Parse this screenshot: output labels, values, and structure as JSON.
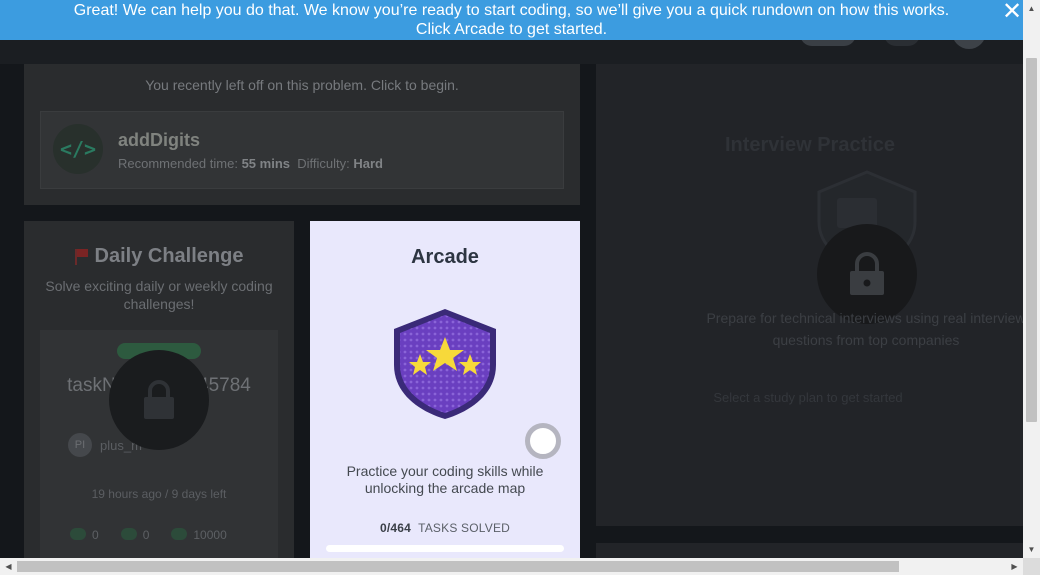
{
  "banner": {
    "line1": "Great! We can help you do that. We know you’re ready to start coding, so we’ll give you a quick rundown on how this works.",
    "line2": "Click Arcade to get started.",
    "close_glyph": "✕"
  },
  "resume": {
    "prompt": "You recently left off on this problem. Click to begin.",
    "problem_name": "addDigits",
    "icon_glyph": "</>",
    "recommended_label": "Recommended time:",
    "recommended_value": "55 mins",
    "difficulty_label": "Difficulty:",
    "difficulty_value": "Hard"
  },
  "daily": {
    "title": "Daily Challenge",
    "subtitle": "Solve exciting daily or weekly coding challenges!",
    "task_name": "taskNPT5aHxR45784",
    "author_initials": "PI",
    "author": "plus_m",
    "time_info": "19 hours ago / 9 days left",
    "stats": [
      "0",
      "0",
      "10000"
    ]
  },
  "arcade": {
    "title": "Arcade",
    "description": "Practice your coding skills while unlocking the arcade map",
    "tasks_count": "0/464",
    "tasks_label": "TASKS SOLVED",
    "progress": 0
  },
  "interview": {
    "title": "Interview Practice",
    "description": "Prepare for technical interviews using real interview questions from top companies",
    "link": "Select a study plan to get started"
  },
  "colors": {
    "banner": "#3c9ce0",
    "arcade_bg": "#e9e8fc",
    "shield_purple": "#6a3fc0",
    "star_yellow": "#f7d93a"
  }
}
